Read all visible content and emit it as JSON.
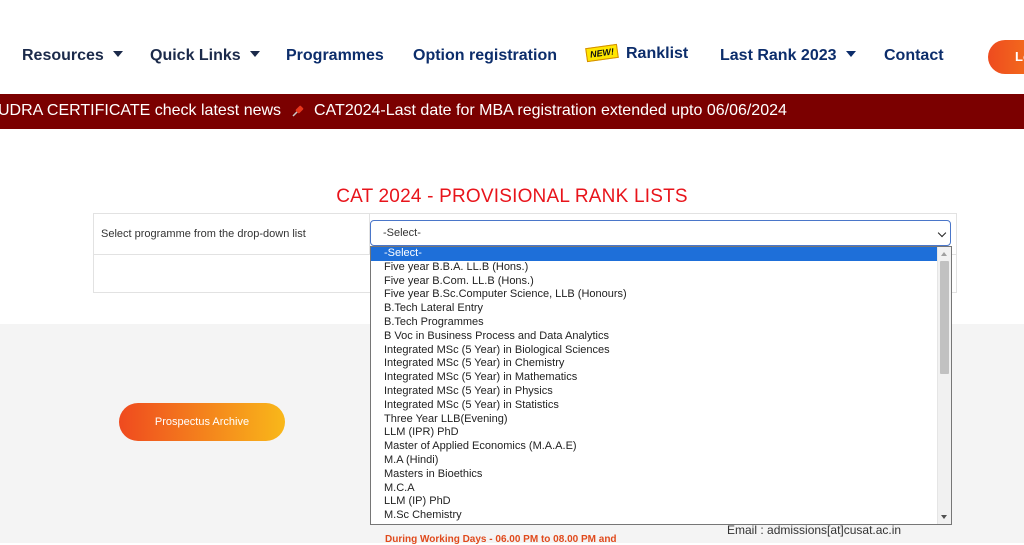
{
  "nav": {
    "items": [
      {
        "label": "Resources",
        "dropdown": true
      },
      {
        "label": "Quick Links",
        "dropdown": true
      },
      {
        "label": "Programmes",
        "dropdown": false
      },
      {
        "label": "Option registration",
        "dropdown": false
      },
      {
        "label": "Ranklist",
        "dropdown": false,
        "badge": "NEW!"
      },
      {
        "label": "Last Rank 2023",
        "dropdown": true
      },
      {
        "label": "Contact",
        "dropdown": false
      }
    ],
    "login_label": "Lo"
  },
  "ticker": {
    "item1": "UDRA CERTIFICATE check latest news",
    "item2": "CAT2024-Last date for MBA registration extended upto 06/06/2024"
  },
  "page_title": "CAT 2024 - PROVISIONAL RANK LISTS",
  "form": {
    "label": "Select programme from the drop-down list",
    "select_value": "-Select-"
  },
  "dropdown_options": [
    "-Select-",
    "Five year B.B.A. LL.B (Hons.)",
    "Five year B.Com. LL.B (Hons.)",
    "Five year B.Sc.Computer Science, LLB (Honours)",
    "B.Tech Lateral Entry",
    "B.Tech Programmes",
    "B Voc in Business Process and Data Analytics",
    "Integrated MSc (5 Year) in Biological Sciences",
    "Integrated MSc (5 Year) in Chemistry",
    "Integrated MSc (5 Year) in Mathematics",
    "Integrated MSc (5 Year) in Physics",
    "Integrated MSc (5 Year) in Statistics",
    "Three Year LLB(Evening)",
    "LLM (IPR) PhD",
    "Master of Applied Economics (M.A.A.E)",
    "M.A (Hindi)",
    "Masters in Bioethics",
    "M.C.A",
    "LLM (IP) PhD",
    "M.Sc Chemistry"
  ],
  "footer": {
    "prospectus_label": "Prospectus Archive",
    "working_days": "During Working Days - 06.00 PM to 08.00 PM and",
    "email_label": "Email",
    "email_value": "admissions[at]cusat.ac.in"
  },
  "colors": {
    "ticker_bg": "#7b0000",
    "title": "#e8141b",
    "nav_text": "#0c2d6b",
    "selected_option": "#1e6fd9"
  }
}
